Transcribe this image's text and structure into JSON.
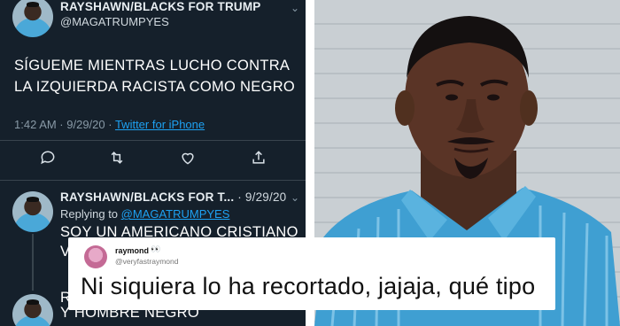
{
  "tweet": {
    "author_name": "RAYSHAWN/BLACKS FOR TRUMP",
    "handle": "@MAGATRUMPYES",
    "text_line1": "SÍGUEME MIENTRAS LUCHO CONTRA",
    "text_line2": "LA IZQUIERDA RACISTA COMO NEGRO",
    "time": "1:42 AM · 9/29/20 · ",
    "source": "Twitter for iPhone"
  },
  "reply": {
    "author_name": "RAYSHAWN/BLACKS FOR T...",
    "date": "· 9/29/20",
    "replying_prefix": "Replying to ",
    "replying_handle": "@MAGATRUMPYES",
    "text_line1": "SOY UN AMERICANO CRISTIANO",
    "text_line2": "V",
    "next_text_prefix": "R",
    "next_text_line": "Y HOMBRE NEGRO"
  },
  "comment": {
    "username": "raymond",
    "emoji": "👀",
    "handle": "@veryfastraymond",
    "text": "Ni siquiera lo ha recortado, jajaja, qué tipo"
  },
  "icons": [
    "reply-icon",
    "retweet-icon",
    "like-icon",
    "share-icon",
    "chevron-down-icon"
  ],
  "colors": {
    "panel_bg": "#15202b",
    "link": "#1da1f2",
    "muted": "#8899a6"
  }
}
